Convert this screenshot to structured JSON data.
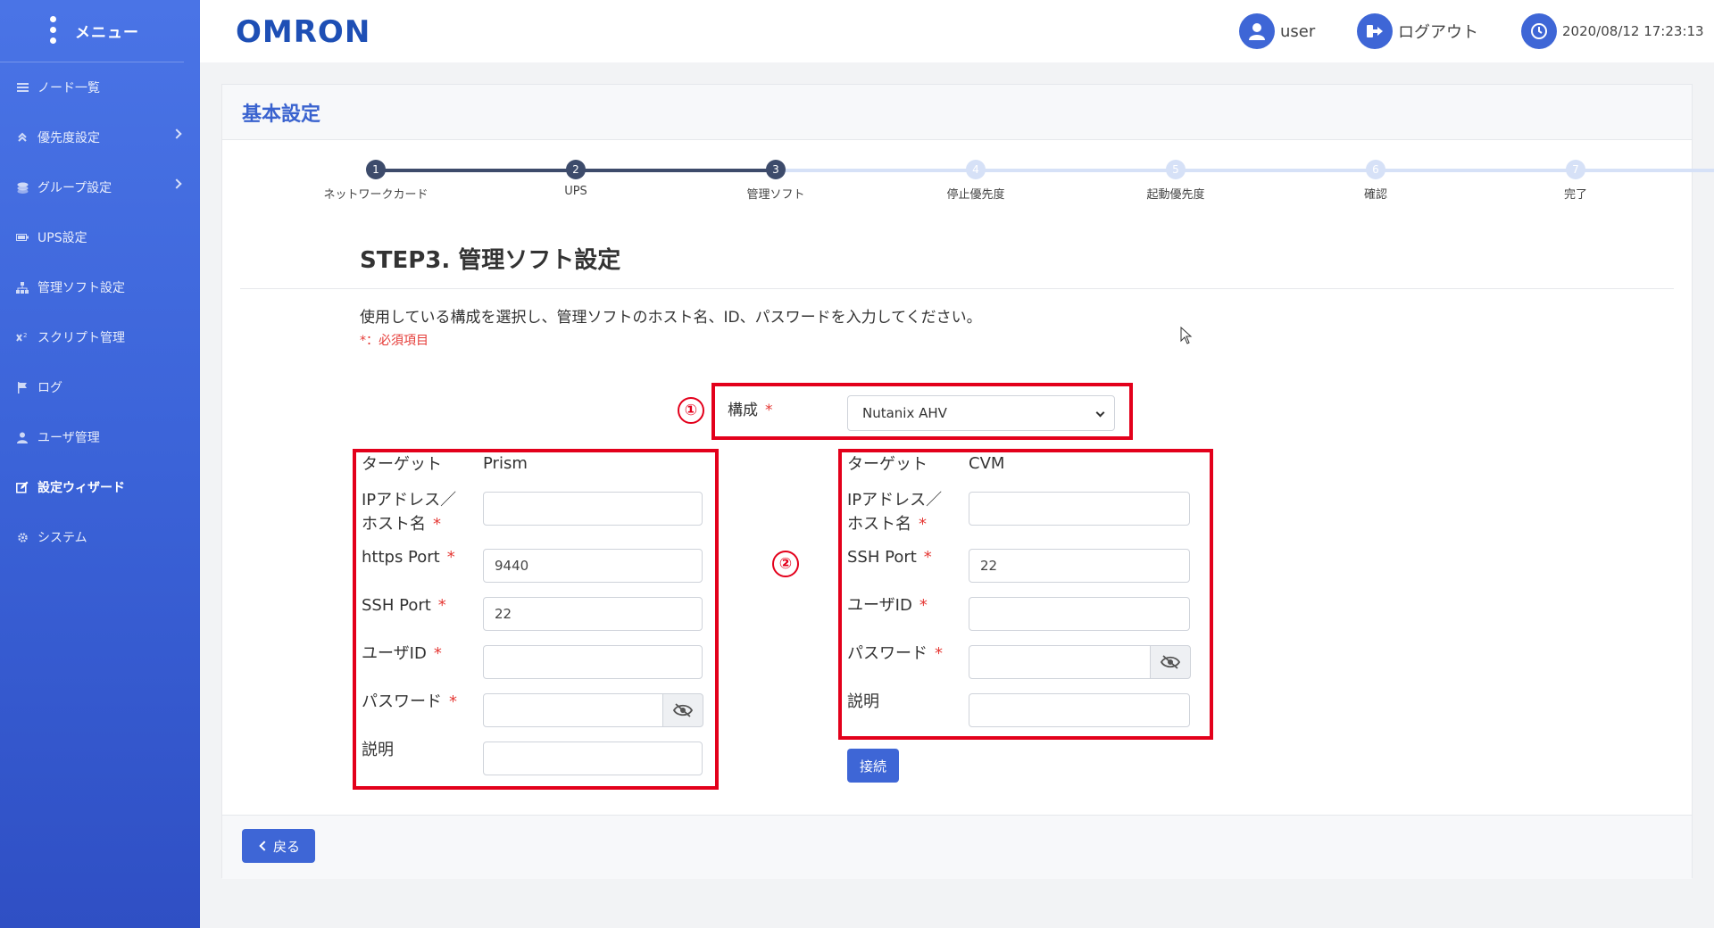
{
  "sidebar": {
    "title": "メニュー",
    "items": [
      {
        "label": "ノード一覧",
        "icon": "list-icon"
      },
      {
        "label": "優先度設定",
        "icon": "priority-icon",
        "has_submenu": true
      },
      {
        "label": "グループ設定",
        "icon": "layers-icon",
        "has_submenu": true
      },
      {
        "label": "UPS設定",
        "icon": "battery-icon"
      },
      {
        "label": "管理ソフト設定",
        "icon": "sitemap-icon"
      },
      {
        "label": "スクリプト管理",
        "icon": "script-icon"
      },
      {
        "label": "ログ",
        "icon": "flag-icon"
      },
      {
        "label": "ユーザ管理",
        "icon": "user-icon"
      },
      {
        "label": "設定ウィザード",
        "icon": "edit-icon",
        "active": true
      },
      {
        "label": "システム",
        "icon": "gear-icon"
      }
    ]
  },
  "header": {
    "logo": "OMRON",
    "user": "user",
    "logout": "ログアウト",
    "datetime": "2020/08/12 17:23:13"
  },
  "page": {
    "title": "基本設定",
    "step_title": "STEP3. 管理ソフト設定",
    "description": "使用している構成を選択し、管理ソフトのホスト名、ID、パスワードを入力してください。",
    "required_note": "*：必須項目"
  },
  "stepper": {
    "current": 3,
    "steps": [
      {
        "num": "1",
        "label": "ネットワークカード"
      },
      {
        "num": "2",
        "label": "UPS"
      },
      {
        "num": "3",
        "label": "管理ソフト"
      },
      {
        "num": "4",
        "label": "停止優先度"
      },
      {
        "num": "5",
        "label": "起動優先度"
      },
      {
        "num": "6",
        "label": "確認"
      },
      {
        "num": "7",
        "label": "完了"
      }
    ]
  },
  "annotations": {
    "one": "①",
    "two": "②",
    "color": "#e3001b"
  },
  "config": {
    "label": "構成",
    "required_mark": "*",
    "selected": "Nutanix AHV"
  },
  "left_form": {
    "target_label": "ターゲット",
    "target_value": "Prism",
    "ip_label_1": "IPアドレス／",
    "ip_label_2": "ホスト名",
    "ip_value": "",
    "https_label": "https Port",
    "https_value": "9440",
    "ssh_label": "SSH Port",
    "ssh_value": "22",
    "userid_label": "ユーザID",
    "userid_value": "",
    "password_label": "パスワード",
    "password_value": "",
    "desc_label": "説明",
    "desc_value": ""
  },
  "right_form": {
    "target_label": "ターゲット",
    "target_value": "CVM",
    "ip_label_1": "IPアドレス／",
    "ip_label_2": "ホスト名",
    "ip_value": "",
    "ssh_label": "SSH Port",
    "ssh_value": "22",
    "userid_label": "ユーザID",
    "userid_value": "",
    "password_label": "パスワード",
    "password_value": "",
    "desc_label": "説明",
    "desc_value": ""
  },
  "buttons": {
    "connect": "接続",
    "back": "戻る"
  },
  "colors": {
    "accent": "#3e66d6",
    "sidebar": "#3b63d8",
    "required": "#e53935",
    "step_done": "#3d4b6b",
    "step_pending": "#d6e1f7"
  }
}
